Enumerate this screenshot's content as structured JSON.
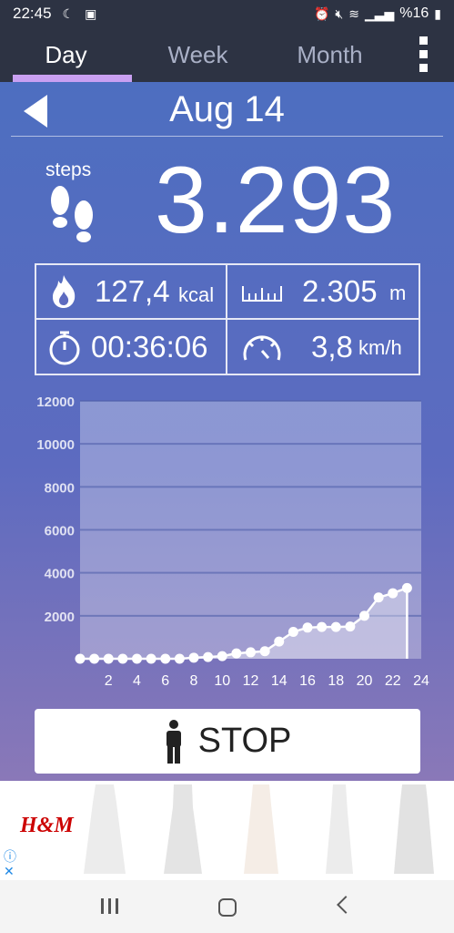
{
  "status_bar": {
    "time": "22:45",
    "battery": "%16",
    "icons_left": [
      "moon-icon",
      "app-notification-icon"
    ],
    "icons_right": [
      "alarm-icon",
      "mute-icon",
      "wifi-icon",
      "signal-icon",
      "battery-icon"
    ]
  },
  "tabs": [
    {
      "label": "Day",
      "active": true
    },
    {
      "label": "Week",
      "active": false
    },
    {
      "label": "Month",
      "active": false
    }
  ],
  "date": "Aug 14",
  "steps": {
    "label": "steps",
    "value": "3.293"
  },
  "stats": {
    "calories": {
      "value": "127,4",
      "unit": "kcal"
    },
    "distance": {
      "value": "2.305",
      "unit": "m"
    },
    "duration": {
      "value": "00:36:06",
      "unit": ""
    },
    "speed": {
      "value": "3,8",
      "unit": "km/h"
    }
  },
  "stop_button": {
    "label": "STOP"
  },
  "ad": {
    "brand": "H&M"
  },
  "colors": {
    "header_bg": "#2d3343",
    "tab_indicator": "#c9a0f2",
    "panel_top": "#4d6ec0",
    "panel_bottom": "#8a78b8"
  },
  "chart_data": {
    "type": "line",
    "x": [
      0,
      1,
      2,
      3,
      4,
      5,
      6,
      7,
      8,
      9,
      10,
      11,
      12,
      13,
      14,
      15,
      16,
      17,
      18,
      19,
      20,
      21,
      22,
      23
    ],
    "y": [
      0,
      0,
      0,
      0,
      0,
      0,
      0,
      0,
      50,
      80,
      120,
      250,
      300,
      350,
      800,
      1250,
      1450,
      1480,
      1480,
      1500,
      2000,
      2850,
      3050,
      3293
    ],
    "xticks": [
      "2",
      "4",
      "6",
      "8",
      "10",
      "12",
      "14",
      "16",
      "18",
      "20",
      "22",
      "24"
    ],
    "yticks": [
      "2000",
      "4000",
      "6000",
      "8000",
      "10000",
      "12000"
    ],
    "xlim": [
      0,
      24
    ],
    "ylim": [
      0,
      12000
    ],
    "grid": true
  }
}
